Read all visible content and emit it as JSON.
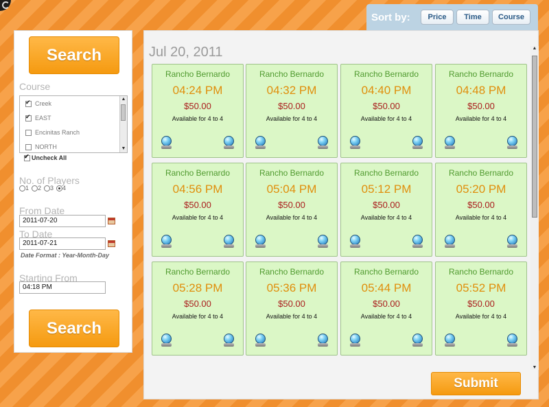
{
  "sort": {
    "label": "Sort by:",
    "buttons": [
      "Price",
      "Time",
      "Course"
    ]
  },
  "sidebar": {
    "search_label": "Search",
    "course_label": "Course",
    "courses": [
      {
        "name": "Creek",
        "checked": true
      },
      {
        "name": "EAST",
        "checked": true
      },
      {
        "name": "Encinitas Ranch",
        "checked": false
      },
      {
        "name": "NORTH",
        "checked": false
      }
    ],
    "uncheck_all": "Uncheck All",
    "players_label": "No. of Players",
    "player_options": [
      "1",
      "2",
      "3",
      "4"
    ],
    "players_selected": "4",
    "from_label": "From Date",
    "from_value": "2011-07-20",
    "to_label": "To Date",
    "to_value": "2011-07-21",
    "date_format": "Date Format : Year-Month-Day",
    "start_label": "Starting From",
    "start_value": "04:18 PM",
    "search_label_bottom": "Search"
  },
  "main": {
    "date": "Jul 20, 2011",
    "slots": [
      {
        "course": "Rancho Bernardo",
        "time": "04:24 PM",
        "price": "$50.00",
        "avail": "Available for 4 to 4"
      },
      {
        "course": "Rancho Bernardo",
        "time": "04:32 PM",
        "price": "$50.00",
        "avail": "Available for 4 to 4"
      },
      {
        "course": "Rancho Bernardo",
        "time": "04:40 PM",
        "price": "$50.00",
        "avail": "Available for 4 to 4"
      },
      {
        "course": "Rancho Bernardo",
        "time": "04:48 PM",
        "price": "$50.00",
        "avail": "Available for 4 to 4"
      },
      {
        "course": "Rancho Bernardo",
        "time": "04:56 PM",
        "price": "$50.00",
        "avail": "Available for 4 to 4"
      },
      {
        "course": "Rancho Bernardo",
        "time": "05:04 PM",
        "price": "$50.00",
        "avail": "Available for 4 to 4"
      },
      {
        "course": "Rancho Bernardo",
        "time": "05:12 PM",
        "price": "$50.00",
        "avail": "Available for 4 to 4"
      },
      {
        "course": "Rancho Bernardo",
        "time": "05:20 PM",
        "price": "$50.00",
        "avail": "Available for 4 to 4"
      },
      {
        "course": "Rancho Bernardo",
        "time": "05:28 PM",
        "price": "$50.00",
        "avail": "Available for 4 to 4"
      },
      {
        "course": "Rancho Bernardo",
        "time": "05:36 PM",
        "price": "$50.00",
        "avail": "Available for 4 to 4"
      },
      {
        "course": "Rancho Bernardo",
        "time": "05:44 PM",
        "price": "$50.00",
        "avail": "Available for 4 to 4"
      },
      {
        "course": "Rancho Bernardo",
        "time": "05:52 PM",
        "price": "$50.00",
        "avail": "Available for 4 to 4"
      }
    ],
    "submit_label": "Submit"
  }
}
